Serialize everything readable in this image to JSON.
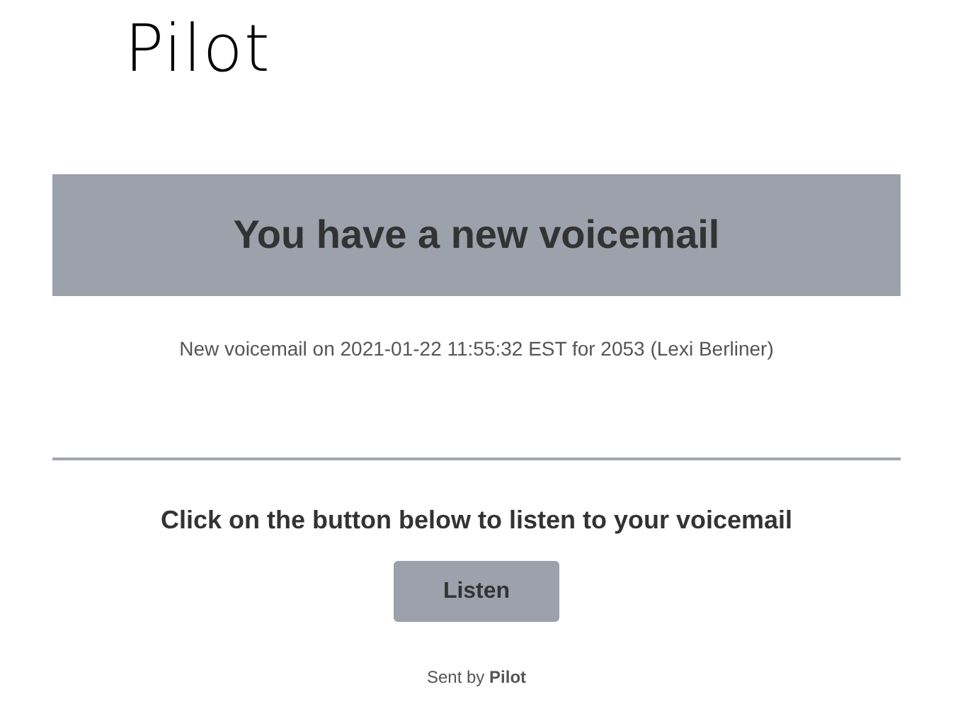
{
  "logo": "Pilot",
  "banner": {
    "title": "You have a new voicemail"
  },
  "details": "New voicemail on 2021-01-22 11:55:32 EST for 2053 (Lexi Berliner)",
  "prompt": "Click on the button below to listen to your voicemail",
  "button": {
    "label": "Listen"
  },
  "footer": "Sent by **Pilot**"
}
